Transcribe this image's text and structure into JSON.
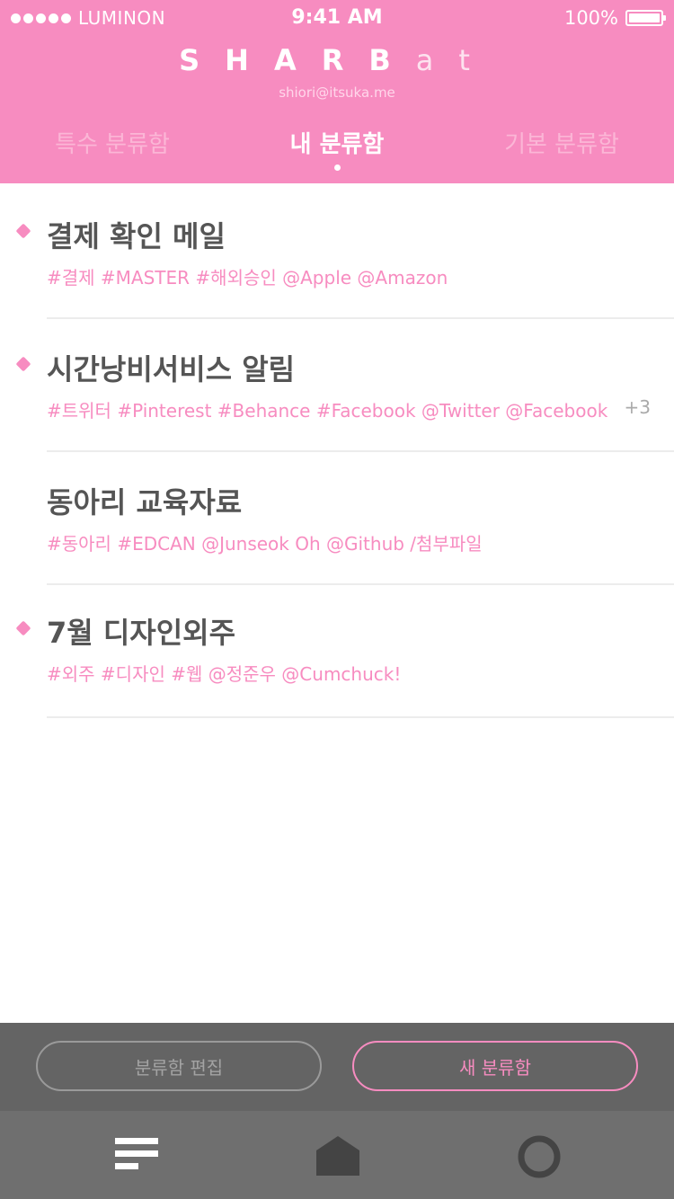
{
  "status_bar": {
    "carrier": "LUMINON",
    "time": "9:41 AM",
    "battery": "100%"
  },
  "header": {
    "brand_bold": "SHARB",
    "brand_light": "at",
    "email": "shiori@itsuka.me",
    "tabs": [
      {
        "label": "특수 분류함",
        "active": false
      },
      {
        "label": "내 분류함",
        "active": true
      },
      {
        "label": "기본 분류함",
        "active": false
      }
    ]
  },
  "items": [
    {
      "title": "결제 확인 메일",
      "tags": "#결제 #MASTER #해외승인 @Apple @Amazon",
      "extra": "",
      "marked": true
    },
    {
      "title": "시간낭비서비스 알림",
      "tags": "#트위터 #Pinterest #Behance #Facebook @Twitter @Facebook",
      "extra": "+3",
      "marked": true
    },
    {
      "title": "동아리 교육자료",
      "tags": "#동아리 #EDCAN @Junseok Oh @Github /첨부파일",
      "extra": "",
      "marked": false
    },
    {
      "title": "7월 디자인외주",
      "tags": "#외주 #디자인 #웹 @정준우 @Cumchuck!",
      "extra": "",
      "marked": true
    }
  ],
  "actions": {
    "edit_label": "분류함 편집",
    "new_label": "새 분류함"
  },
  "nav": {
    "icons": [
      "list-icon",
      "home-icon",
      "circle-icon"
    ]
  },
  "colors": {
    "accent": "#f78cc0",
    "title_text": "#555555",
    "action_bar": "#646464",
    "bottom_nav": "#6f6f6f"
  }
}
